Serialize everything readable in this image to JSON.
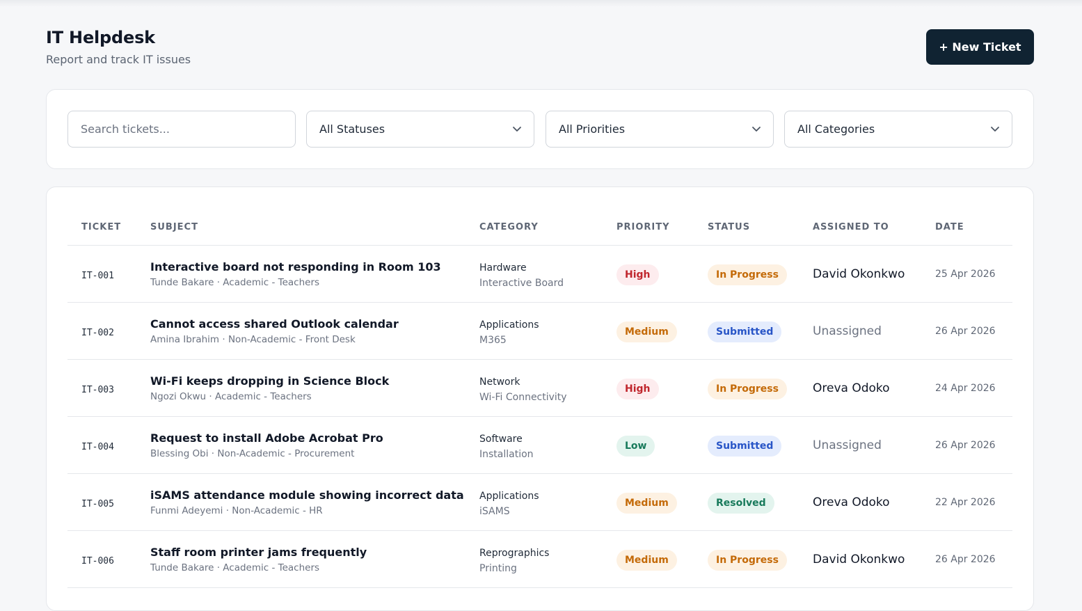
{
  "header": {
    "title": "IT Helpdesk",
    "subtitle": "Report and track IT issues",
    "new_ticket_label": "+ New Ticket"
  },
  "filters": {
    "search_placeholder": "Search tickets...",
    "status_selected": "All Statuses",
    "priority_selected": "All Priorities",
    "category_selected": "All Categories"
  },
  "table": {
    "columns": [
      "Ticket",
      "Subject",
      "Category",
      "Priority",
      "Status",
      "Assigned To",
      "Date"
    ],
    "rows": [
      {
        "id": "IT-001",
        "subject": "Interactive board not responding in Room 103",
        "requester": "Tunde Bakare · Academic - Teachers",
        "category": "Hardware",
        "subcategory": "Interactive Board",
        "priority": "High",
        "status": "In Progress",
        "assigned": "David Okonkwo",
        "date": "25 Apr 2026"
      },
      {
        "id": "IT-002",
        "subject": "Cannot access shared Outlook calendar",
        "requester": "Amina Ibrahim · Non-Academic - Front Desk",
        "category": "Applications",
        "subcategory": "M365",
        "priority": "Medium",
        "status": "Submitted",
        "assigned": "Unassigned",
        "date": "26 Apr 2026"
      },
      {
        "id": "IT-003",
        "subject": "Wi-Fi keeps dropping in Science Block",
        "requester": "Ngozi Okwu · Academic - Teachers",
        "category": "Network",
        "subcategory": "Wi-Fi Connectivity",
        "priority": "High",
        "status": "In Progress",
        "assigned": "Oreva Odoko",
        "date": "24 Apr 2026"
      },
      {
        "id": "IT-004",
        "subject": "Request to install Adobe Acrobat Pro",
        "requester": "Blessing Obi · Non-Academic - Procurement",
        "category": "Software",
        "subcategory": "Installation",
        "priority": "Low",
        "status": "Submitted",
        "assigned": "Unassigned",
        "date": "26 Apr 2026"
      },
      {
        "id": "IT-005",
        "subject": "iSAMS attendance module showing incorrect data",
        "requester": "Funmi Adeyemi · Non-Academic - HR",
        "category": "Applications",
        "subcategory": "iSAMS",
        "priority": "Medium",
        "status": "Resolved",
        "assigned": "Oreva Odoko",
        "date": "22 Apr 2026"
      },
      {
        "id": "IT-006",
        "subject": "Staff room printer jams frequently",
        "requester": "Tunde Bakare · Academic - Teachers",
        "category": "Reprographics",
        "subcategory": "Printing",
        "priority": "Medium",
        "status": "In Progress",
        "assigned": "David Okonkwo",
        "date": "26 Apr 2026"
      }
    ]
  },
  "colors": {
    "primary_button": "#102332",
    "priority_high_bg": "#fdecee",
    "priority_high_fg": "#c0262d",
    "priority_medium_bg": "#fdf1e2",
    "priority_medium_fg": "#c46a08",
    "priority_low_bg": "#e3f4ee",
    "priority_low_fg": "#187a5b",
    "status_in_progress_bg": "#fdf1e2",
    "status_in_progress_fg": "#c46a08",
    "status_submitted_bg": "#e4ecfd",
    "status_submitted_fg": "#2855c7",
    "status_resolved_bg": "#e3f4ee",
    "status_resolved_fg": "#187a5b"
  },
  "icons": {
    "dropdown": "chevron-down-icon"
  }
}
